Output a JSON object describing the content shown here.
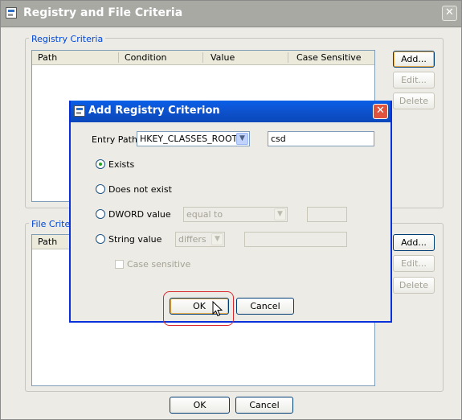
{
  "window": {
    "title": "Registry and File Criteria",
    "close_glyph": "✕"
  },
  "registry_criteria": {
    "label": "Registry Criteria",
    "columns": [
      "Path",
      "Condition",
      "Value",
      "Case Sensitive"
    ],
    "buttons": {
      "add": "Add...",
      "edit": "Edit...",
      "delete": "Delete"
    }
  },
  "file_criteria": {
    "label": "File Criteria",
    "columns": [
      "Path"
    ],
    "buttons": {
      "add": "Add...",
      "edit": "Edit...",
      "delete": "Delete"
    }
  },
  "footer": {
    "ok": "OK",
    "cancel": "Cancel"
  },
  "dialog": {
    "title": "Add Registry Criterion",
    "close_glyph": "✕",
    "entry_path_label": "Entry Path:",
    "entry_path_value": "HKEY_CLASSES_ROOT\\",
    "key_value": "csd",
    "radio_exists": "Exists",
    "radio_does_not_exist": "Does not exist",
    "radio_dword": "DWORD value",
    "dword_operator": "equal to",
    "radio_string": "String value",
    "string_operator": "differs",
    "case_sensitive_label": "Case sensitive",
    "selected_option": "Exists",
    "ok": "OK",
    "cancel": "Cancel"
  },
  "colors": {
    "dialog_titlebar": "#0a5fe8",
    "group_label": "#0046d5",
    "highlight": "#d8292f"
  }
}
